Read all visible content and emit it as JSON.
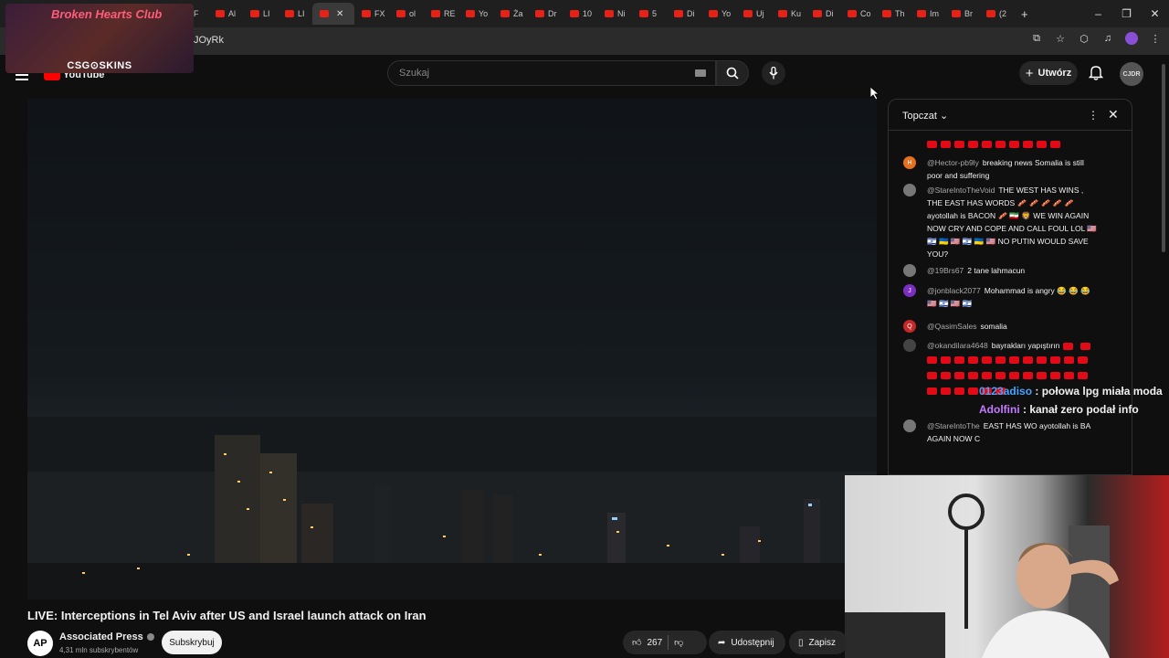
{
  "browser": {
    "tabs": [
      "F",
      "Al",
      "LI",
      "LI",
      "",
      "FX",
      "ol",
      "RE",
      "Yo",
      "Ża",
      "Dr",
      "10",
      "Ni",
      "5",
      "Di",
      "Yo",
      "Uj",
      "Ku",
      "Di",
      "Co",
      "Th",
      "Im",
      "Br",
      "(2"
    ],
    "active_tab_index": 4,
    "url_fragment": "JOyRk"
  },
  "overlay": {
    "neon_text": "Broken Hearts Club",
    "brand": "CSG⊙SKINS"
  },
  "youtube": {
    "logo_text": "YouTube",
    "search_placeholder": "Szukaj",
    "create_label": "Utwórz",
    "avatar_text": "CJDR"
  },
  "video": {
    "title": "LIVE: Interceptions in Tel Aviv after US and Israel launch attack on Iran",
    "channel": "Associated Press",
    "channel_avatar": "AP",
    "subscribers": "4,31 mln subskrybentów",
    "subscribe_label": "Subskrybuj",
    "likes": "267",
    "share_label": "Udostępnij",
    "save_label": "Zapisz"
  },
  "chat": {
    "title": "Topczat",
    "messages": [
      {
        "avatar": "H",
        "color": "#e6701f",
        "author": "@Hector-pb9ly",
        "text": "breaking news Somalia is still poor and suffering"
      },
      {
        "avatar": "",
        "color": "#777777",
        "author": "@StareIntoTheVoid",
        "text": "THE WEST HAS WINS , THE EAST HAS WORDS 🥓 🥓 🥓 🥓 🥓 ayotollah is BACON 🥓 🇮🇷 🦁 WE WIN AGAIN NOW CRY AND COPE AND CALL FOUL LOL 🇺🇸 🇮🇱 🇺🇦 🇺🇸 🇮🇱 🇺🇦 🇺🇸 NO PUTIN WOULD SAVE YOU?"
      },
      {
        "avatar": "",
        "color": "#777777",
        "author": "@19Brs67",
        "text": "2 tane lahmacun"
      },
      {
        "avatar": "J",
        "color": "#7b2fbf",
        "author": "@jonblack2077",
        "text": "Mohammad is angry 😂 😂 😂 🇺🇸 🇮🇱 🇺🇸 🇮🇱"
      },
      {
        "avatar": "Q",
        "color": "#c62828",
        "author": "@QasimSales",
        "text": "somalia"
      },
      {
        "avatar": "",
        "color": "#444444",
        "author": "@okandilara4648",
        "text": "bayrakları yapıştırın"
      },
      {
        "avatar": "",
        "color": "#777777",
        "author": "@StareIntoThe",
        "text": "EAST HAS WO ayotollah is BA AGAIN NOW C"
      }
    ]
  },
  "twitch_chat": [
    {
      "user": "0123adiso",
      "text": ": połowa lpg miała moda"
    },
    {
      "user": "Adolfini",
      "text": ": kanał zero podał info"
    }
  ]
}
